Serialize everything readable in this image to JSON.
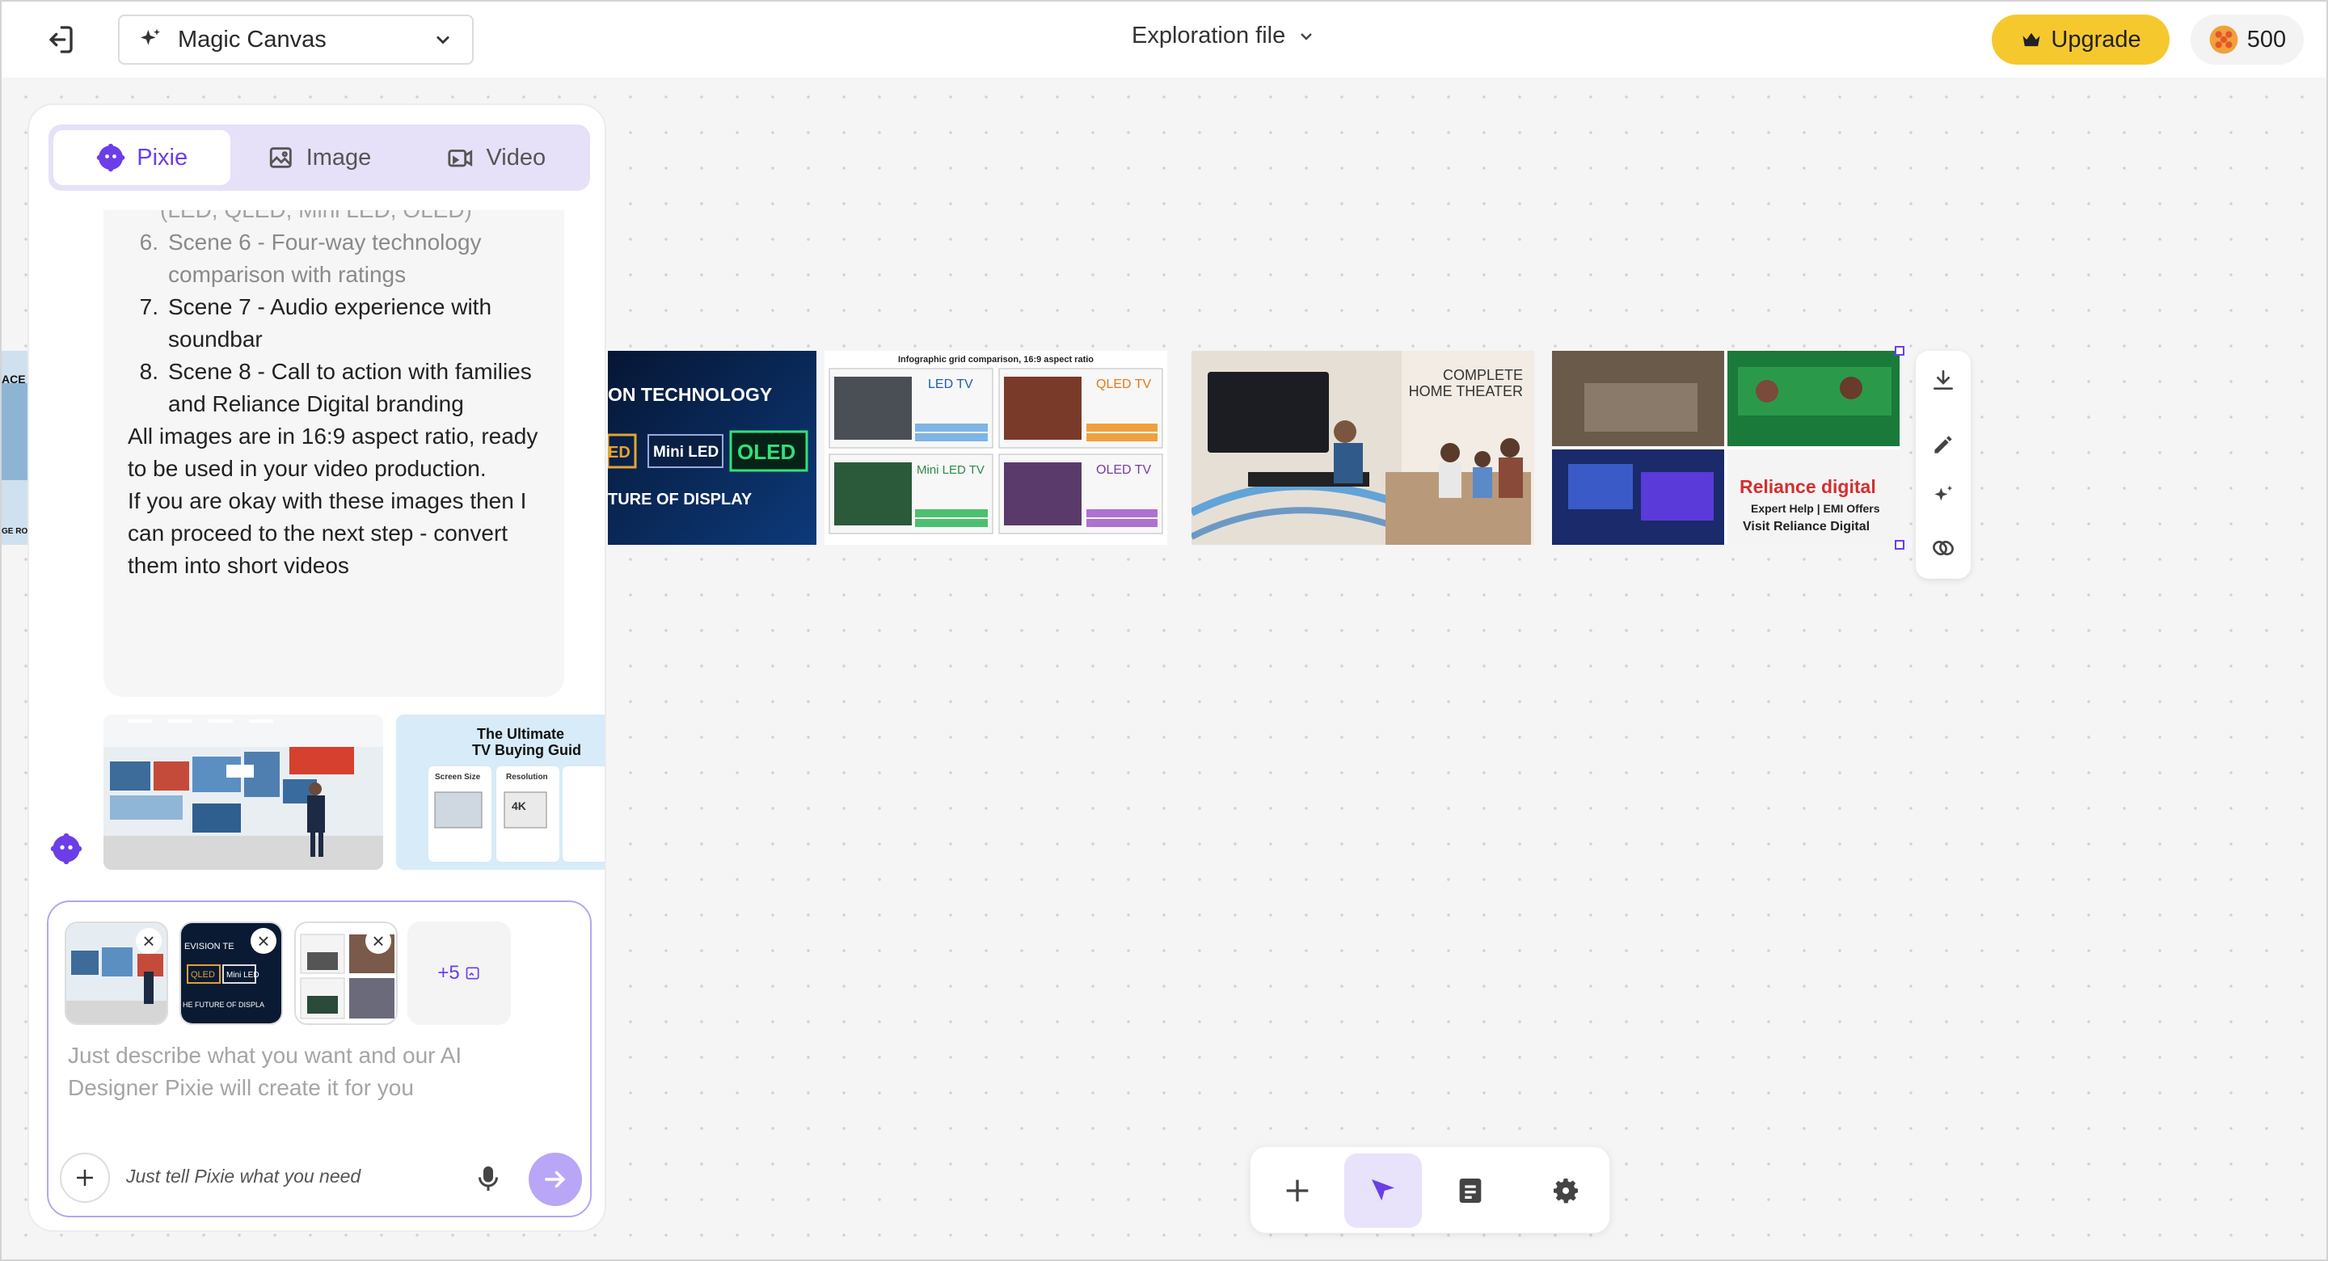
{
  "header": {
    "canvas_name": "Magic Canvas",
    "file_name": "Exploration file",
    "upgrade_label": "Upgrade",
    "credits": "500",
    "accent_color": "#f5c82e"
  },
  "sidebar": {
    "tabs": [
      {
        "label": "Pixie",
        "icon": "pixie-icon",
        "active": true
      },
      {
        "label": "Image",
        "icon": "image-icon",
        "active": false
      },
      {
        "label": "Video",
        "icon": "video-icon",
        "active": false
      }
    ],
    "message": {
      "partial_line": "(LED, QLED, Mini LED, OLED)",
      "items": [
        {
          "num": "6.",
          "text": "Scene 6 - Four-way technology comparison with ratings"
        },
        {
          "num": "7.",
          "text": "Scene 7 - Audio experience with soundbar"
        },
        {
          "num": "8.",
          "text": "Scene 8 - Call to action with families and Reliance Digital branding"
        }
      ],
      "paragraph1": "All images are in 16:9 aspect ratio, ready to be used in your video production.",
      "paragraph2": "If you are okay with these images then I can proceed to the next step - convert them into short videos"
    },
    "thumbnails": [
      {
        "name": "store-scene",
        "text": ""
      },
      {
        "name": "buying-guide",
        "title": "The Ultimate TV Buying Guide",
        "col1": "Screen Size",
        "col2": "Resolution"
      }
    ],
    "composer": {
      "more_count": "+5",
      "placeholder": "Just describe what you want and our AI Designer Pixie will create it for you",
      "hint": "Just tell Pixie what you need"
    }
  },
  "canvas": {
    "images": [
      {
        "name": "technology-scene",
        "line1": "ON TECHNOLOGY",
        "line2": "TURE OF DISPLAY",
        "badges": [
          "ED",
          "Mini LED",
          "OLED"
        ]
      },
      {
        "name": "comparison-grid",
        "title": "Infographic grid comparison, 16:9 aspect ratio",
        "cells": [
          "LED TV",
          "QLED TV",
          "Mini LED TV",
          "OLED TV"
        ]
      },
      {
        "name": "home-theater",
        "line1": "COMPLETE",
        "line2": "HOME THEATER"
      },
      {
        "name": "reliance-cta",
        "brand": "Reliance digital",
        "tagline": "Expert Help | EMI Offers",
        "cta": "Visit Reliance Digital"
      }
    ],
    "left_partial": {
      "top": "ACE",
      "bottom": "GE RO"
    }
  }
}
